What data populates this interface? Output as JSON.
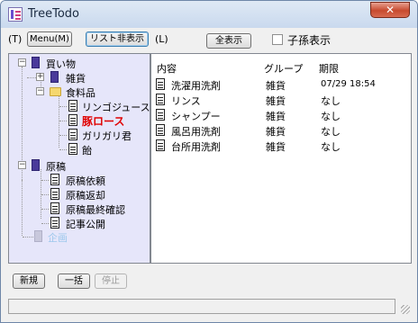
{
  "window": {
    "title": "TreeTodo",
    "close_glyph": "✕"
  },
  "toolbar": {
    "tree_shortcut": "(T)",
    "menu_button": "Menu(M)",
    "list_hide_button": "リスト非表示",
    "list_shortcut": "(L)",
    "show_all_button": "全表示",
    "child_display_label": "子孫表示",
    "child_display_checked": false
  },
  "tree": {
    "nodes": [
      {
        "label": "買い物",
        "icon": "book-icon",
        "expander": "−"
      },
      {
        "label": "雑貨",
        "icon": "book-icon",
        "expander": "+"
      },
      {
        "label": "食料品",
        "icon": "folder-icon",
        "expander": "−"
      },
      {
        "label": "リンゴジュース",
        "icon": "doc-icon"
      },
      {
        "label": "豚ロース",
        "icon": "doc-icon",
        "highlight": true
      },
      {
        "label": "ガリガリ君",
        "icon": "doc-icon"
      },
      {
        "label": "飴",
        "icon": "doc-icon"
      },
      {
        "label": "原稿",
        "icon": "book-icon",
        "expander": "−"
      },
      {
        "label": "原稿依頼",
        "icon": "doc-icon"
      },
      {
        "label": "原稿返却",
        "icon": "doc-icon"
      },
      {
        "label": "原稿最終確認",
        "icon": "doc-icon"
      },
      {
        "label": "記事公開",
        "icon": "doc-icon"
      },
      {
        "label": "企画",
        "icon": "book-icon",
        "dim": true
      }
    ]
  },
  "list": {
    "headers": [
      "内容",
      "グループ",
      "期限"
    ],
    "rows": [
      {
        "content": "洗濯用洗剤",
        "group": "雑貨",
        "due": "07/29 18:54"
      },
      {
        "content": "リンス",
        "group": "雑貨",
        "due": "なし"
      },
      {
        "content": "シャンプー",
        "group": "雑貨",
        "due": "なし"
      },
      {
        "content": "風呂用洗剤",
        "group": "雑貨",
        "due": "なし"
      },
      {
        "content": "台所用洗剤",
        "group": "雑貨",
        "due": "なし"
      }
    ]
  },
  "bottom": {
    "new_button": "新規",
    "batch_button": "一括",
    "stop_button": "停止"
  },
  "status": {
    "text": ""
  },
  "colors": {
    "highlight": "#e00000",
    "tree_bg": "#e6e6fa",
    "dim_text": "#9ec8ec"
  }
}
